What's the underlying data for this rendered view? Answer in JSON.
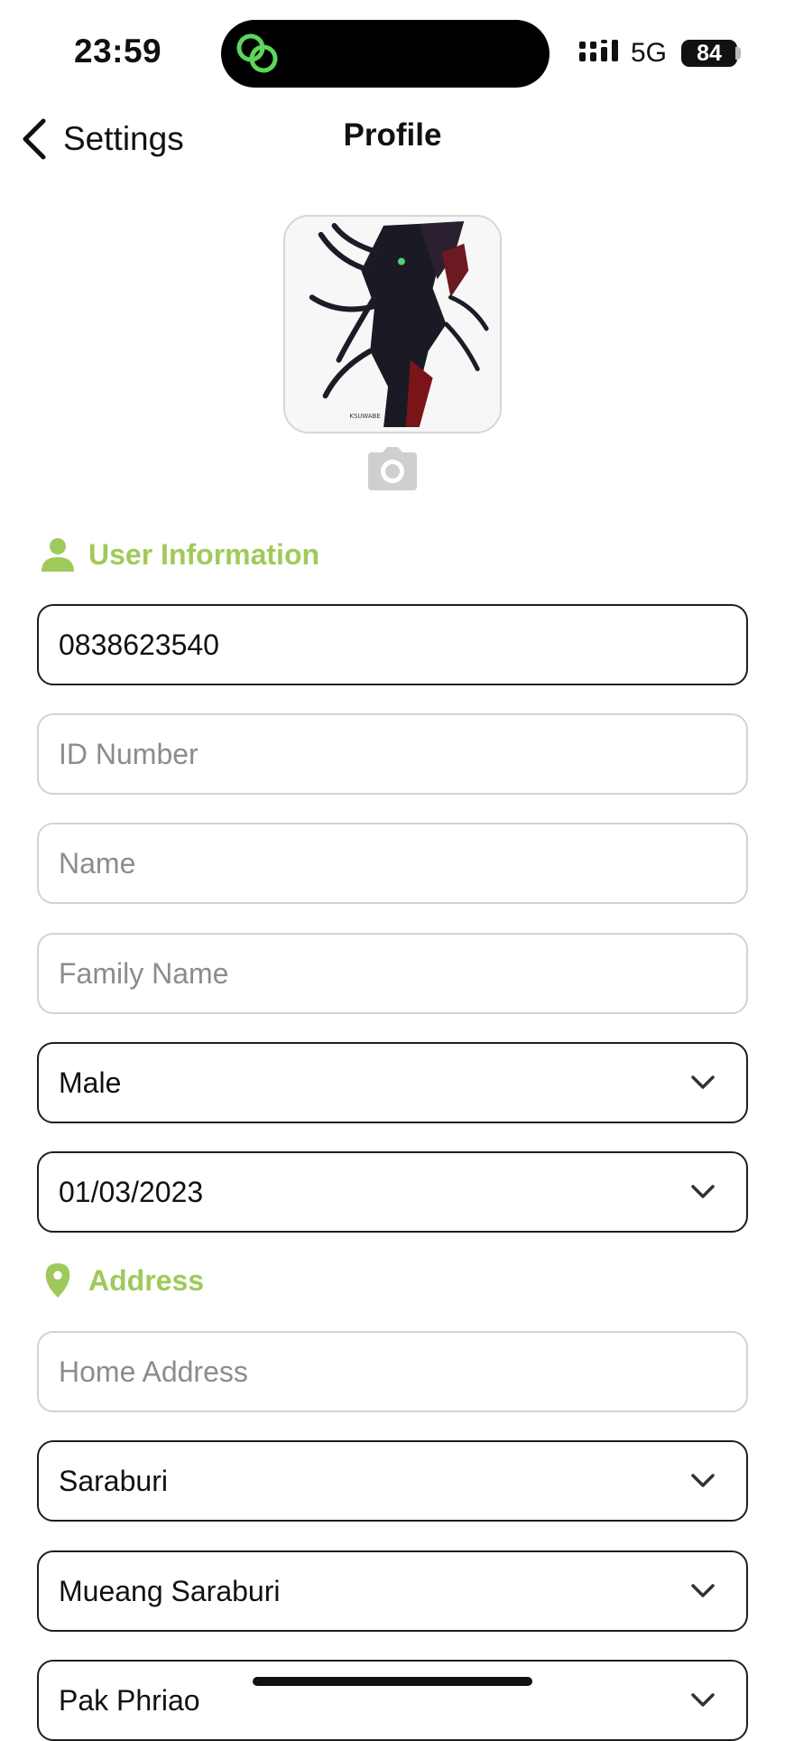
{
  "status_bar": {
    "time": "23:59",
    "network": "5G",
    "battery": "84",
    "island_icon": "link-chat-icon",
    "island_icon_color": "#5cd65c"
  },
  "nav": {
    "back_label": "Settings",
    "title": "Profile"
  },
  "avatar": {
    "alt": "profile-photo",
    "caption": "KSUWABE"
  },
  "sections": {
    "user_info": {
      "title": "User Information",
      "icon": "person-icon"
    },
    "address": {
      "title": "Address",
      "icon": "location-pin-icon"
    }
  },
  "fields": {
    "phone": {
      "value": "0838623540"
    },
    "id_number": {
      "placeholder": "ID Number"
    },
    "name": {
      "placeholder": "Name"
    },
    "family_name": {
      "placeholder": "Family Name"
    },
    "gender": {
      "value": "Male"
    },
    "birth_date": {
      "value": "01/03/2023"
    },
    "home_address": {
      "placeholder": "Home Address"
    },
    "province": {
      "value": "Saraburi"
    },
    "district": {
      "value": "Mueang Saraburi"
    },
    "subdistrict": {
      "value": "Pak Phriao"
    }
  },
  "colors": {
    "accent": "#9fca5b",
    "field_border_filled": "#1e1e1e",
    "field_border_empty": "#d2d2d2"
  }
}
